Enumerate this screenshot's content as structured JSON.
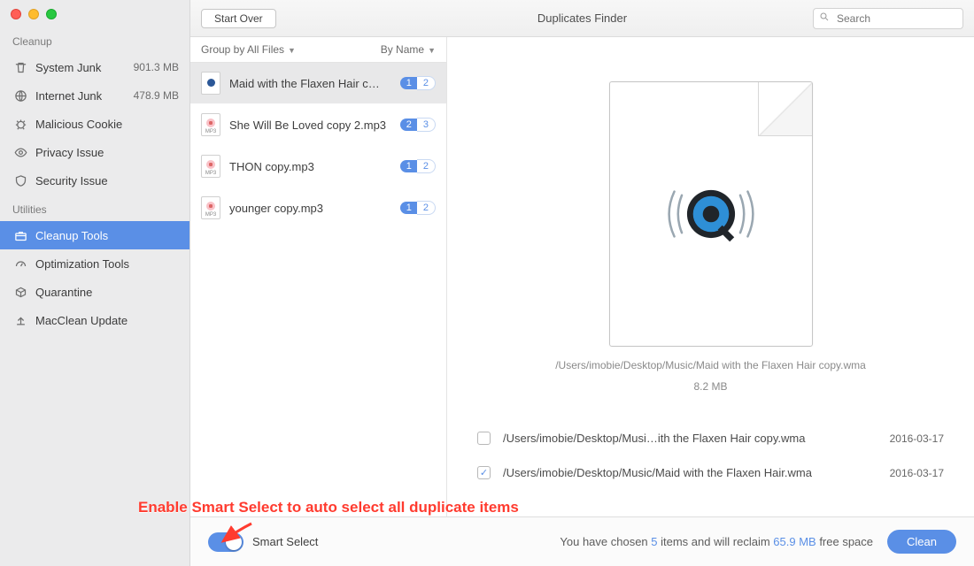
{
  "window": {
    "title": "Duplicates Finder"
  },
  "toolbar": {
    "start_over": "Start Over",
    "search_placeholder": "Search"
  },
  "sidebar": {
    "section_cleanup": "Cleanup",
    "section_utilities": "Utilities",
    "cleanup_items": [
      {
        "label": "System Junk",
        "meta": "901.3 MB"
      },
      {
        "label": "Internet Junk",
        "meta": "478.9 MB"
      },
      {
        "label": "Malicious Cookie",
        "meta": ""
      },
      {
        "label": "Privacy Issue",
        "meta": ""
      },
      {
        "label": "Security Issue",
        "meta": ""
      }
    ],
    "utilities_items": [
      {
        "label": "Cleanup Tools",
        "meta": ""
      },
      {
        "label": "Optimization Tools",
        "meta": ""
      },
      {
        "label": "Quarantine",
        "meta": ""
      },
      {
        "label": "MacClean Update",
        "meta": ""
      }
    ]
  },
  "list": {
    "group_label": "Group by All Files",
    "sort_label": "By Name",
    "rows": [
      {
        "name": "Maid with the Flaxen Hair c…",
        "sel": "1",
        "tot": "2",
        "kind": "wma"
      },
      {
        "name": "She Will Be Loved copy 2.mp3",
        "sel": "2",
        "tot": "3",
        "kind": "mp3"
      },
      {
        "name": "THON copy.mp3",
        "sel": "1",
        "tot": "2",
        "kind": "mp3"
      },
      {
        "name": "younger copy.mp3",
        "sel": "1",
        "tot": "2",
        "kind": "mp3"
      }
    ]
  },
  "preview": {
    "path": "/Users/imobie/Desktop/Music/Maid with the Flaxen Hair copy.wma",
    "size": "8.2 MB"
  },
  "duplicates": [
    {
      "checked": false,
      "path": "/Users/imobie/Desktop/Musi…ith the Flaxen Hair copy.wma",
      "date": "2016-03-17"
    },
    {
      "checked": true,
      "path": "/Users/imobie/Desktop/Music/Maid with the Flaxen Hair.wma",
      "date": "2016-03-17"
    }
  ],
  "bottom": {
    "smart_select_label": "Smart Select",
    "status_prefix": "You have chosen ",
    "status_items": "5",
    "status_mid": " items and will reclaim ",
    "status_size": "65.9 MB",
    "status_suffix": " free space",
    "clean_label": "Clean"
  },
  "callout": {
    "text": "Enable Smart Select to auto select all duplicate items"
  }
}
